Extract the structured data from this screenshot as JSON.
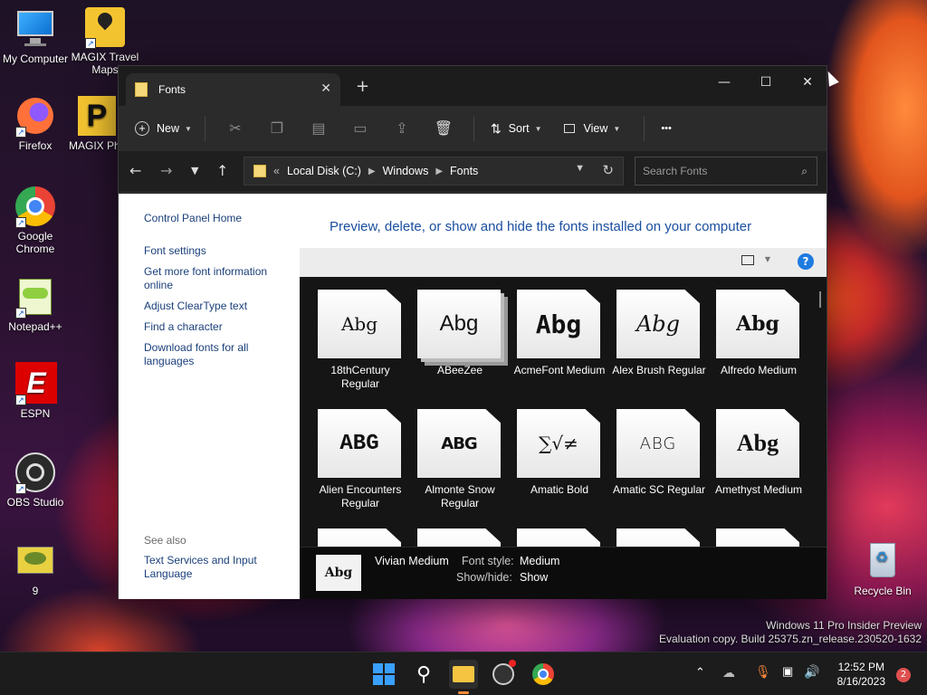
{
  "desktop": {
    "icons": [
      {
        "label": "My Computer"
      },
      {
        "label": "MAGIX Travel Maps"
      },
      {
        "label": "Firefox"
      },
      {
        "label": "MAGIX Photosto"
      },
      {
        "label": "Google Chrome"
      },
      {
        "label": "Notepad++"
      },
      {
        "label": "ESPN"
      },
      {
        "label": "OBS Studio"
      },
      {
        "label": "9"
      },
      {
        "label": "Recycle Bin"
      }
    ],
    "watermark_line1": "Windows 11 Pro Insider Preview",
    "watermark_line2": "Evaluation copy. Build 25375.zn_release.230520-1632"
  },
  "window": {
    "tab_title": "Fonts",
    "toolbar": {
      "new_label": "New",
      "sort_label": "Sort",
      "view_label": "View",
      "more_label": "•••"
    },
    "address": {
      "overflow": "«",
      "crumbs": [
        "Local Disk (C:)",
        "Windows",
        "Fonts"
      ]
    },
    "search": {
      "placeholder": "Search Fonts"
    },
    "left_pane": {
      "control_panel_home": "Control Panel Home",
      "links": [
        "Font settings",
        "Get more font information online",
        "Adjust ClearType text",
        "Find a character",
        "Download fonts for all languages"
      ],
      "see_also": "See also",
      "see_also_links": [
        "Text Services and Input Language"
      ]
    },
    "heading": "Preview, delete, or show and hide the fonts installed on your computer",
    "fonts": [
      {
        "name": "18thCentury Regular",
        "sample": "Abg"
      },
      {
        "name": "ABeeZee",
        "sample": "Abg"
      },
      {
        "name": "AcmeFont Medium",
        "sample": "Abg"
      },
      {
        "name": "Alex Brush Regular",
        "sample": "Abg"
      },
      {
        "name": "Alfredo Medium",
        "sample": "Abg"
      },
      {
        "name": "Alien Encounters Regular",
        "sample": "ABG"
      },
      {
        "name": "Almonte Snow Regular",
        "sample": "ABG"
      },
      {
        "name": "Amatic Bold",
        "sample": "∑√≠"
      },
      {
        "name": "Amatic SC Regular",
        "sample": "ABG"
      },
      {
        "name": "Amethyst Medium",
        "sample": "Abg"
      }
    ],
    "details": {
      "name": "Vivian Medium",
      "sample": "Abg",
      "style_label": "Font style:",
      "style_value": "Medium",
      "showhide_label": "Show/hide:",
      "showhide_value": "Show"
    }
  },
  "taskbar": {
    "time": "12:52 PM",
    "date": "8/16/2023",
    "notification_count": "2"
  }
}
